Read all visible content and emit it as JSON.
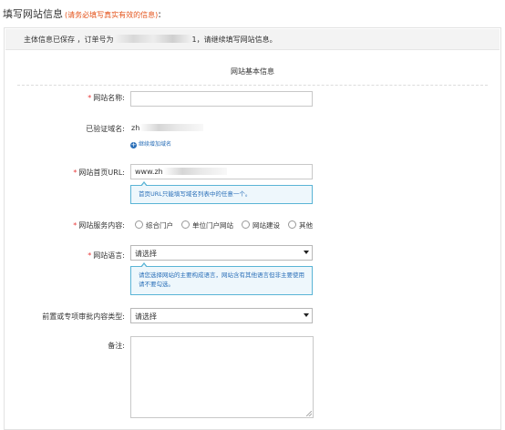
{
  "header": {
    "title": "填写网站信息",
    "warning": "(请务必填写真实有效的信息)",
    "colon": ":"
  },
  "notice": {
    "prefix": "主体信息已保存 ，订单号为",
    "order_suffix": "1",
    "suffix": "，请继续填写网站信息。"
  },
  "section": {
    "title": "网站基本信息"
  },
  "fields": {
    "site_name": {
      "label": "网站名称:",
      "value": ""
    },
    "verified_domain": {
      "label": "已验证域名:",
      "value": "zh"
    },
    "add_domain": {
      "label": "继续增加域名"
    },
    "homepage_url": {
      "label": "网站首页URL:",
      "value": "www.zh",
      "tip": "首页URL只能填写域名列表中的任意一个。"
    },
    "service_content": {
      "label": "网站服务内容:",
      "options": [
        "综合门户",
        "单位门户网站",
        "网站建设",
        "其他"
      ]
    },
    "site_language": {
      "label": "网站语言:",
      "value": "请选择",
      "tip": "请您选择网站的主要构成语言，网站含有其他语言但非主要使用请不要勾选。"
    },
    "preapproval_type": {
      "label": "前置或专项审批内容类型:",
      "value": "请选择"
    },
    "remark": {
      "label": "备注:",
      "value": ""
    }
  },
  "colors": {
    "required_star": "#e83a3a",
    "warning_text": "#e4541c",
    "link_blue": "#2a6fb8",
    "tip_border": "#5ab4d6",
    "tip_bg": "#eef7fc"
  },
  "icons": {
    "add": "plus-circle-icon",
    "dropdown": "chevron-down-icon"
  }
}
